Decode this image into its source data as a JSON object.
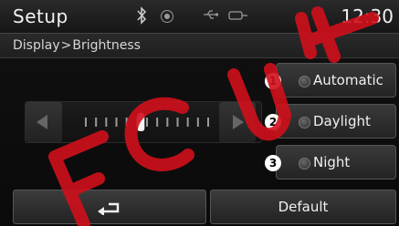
{
  "header": {
    "title": "Setup",
    "clock": "12:30",
    "icons": [
      "bluetooth-icon",
      "record-icon",
      "usb-icon",
      "plug-icon"
    ]
  },
  "breadcrumb": {
    "parent": "Display",
    "separator": ">",
    "current": "Brightness"
  },
  "brightness_slider": {
    "left_arrow": "left-arrow-icon",
    "right_arrow": "right-arrow-icon",
    "level_fraction": 0.45,
    "tick_count": 13
  },
  "options": [
    {
      "badge": "1",
      "label": "Automatic"
    },
    {
      "badge": "2",
      "label": "Daylight"
    },
    {
      "badge": "3",
      "label": "Night"
    }
  ],
  "footer": {
    "back_icon": "back-arrow-icon",
    "default_label": "Default"
  },
  "watermark": {
    "text": "ECU",
    "color": "#d0101c"
  }
}
